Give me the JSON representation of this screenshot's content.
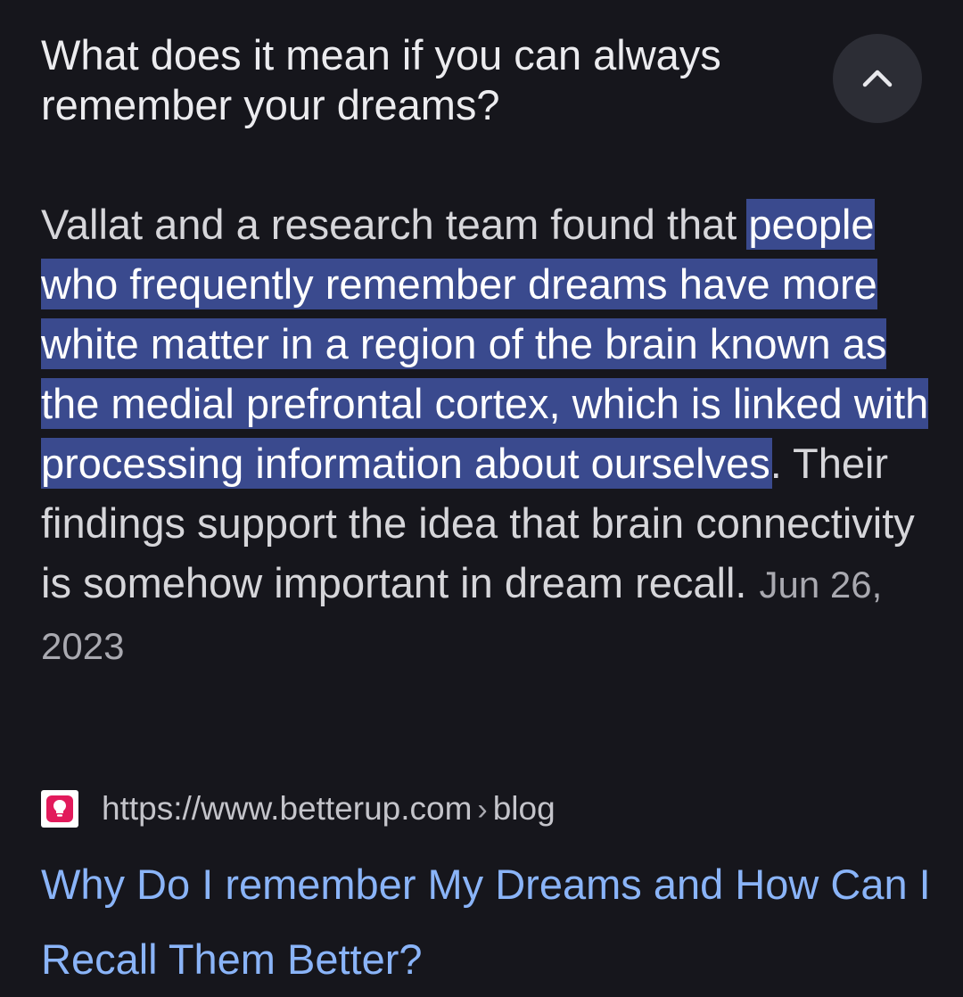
{
  "question": "What does it mean if you can always remember your dreams?",
  "snippet": {
    "before": "Vallat and a research team found that ",
    "highlighted": "people who frequently remember dreams have more white matter in a region of the brain known as the medial prefrontal cortex, which is linked with processing information about ourselves",
    "after": ". Their findings support the idea that brain connectivity is somehow important in dream recall.",
    "date": "Jun 26, 2023"
  },
  "source": {
    "favicon": "betterup-lightbulb-icon",
    "url_domain": "https://www.betterup.com",
    "separator": "›",
    "url_path": "blog"
  },
  "result": {
    "title": "Why Do I remember My Dreams and How Can I Recall Them Better?"
  },
  "colors": {
    "background": "#16161c",
    "highlight": "#3a4a8e",
    "link": "#8ab4f8",
    "favicon": "#e21a5b"
  },
  "icons": {
    "collapse": "chevron-up-icon"
  }
}
